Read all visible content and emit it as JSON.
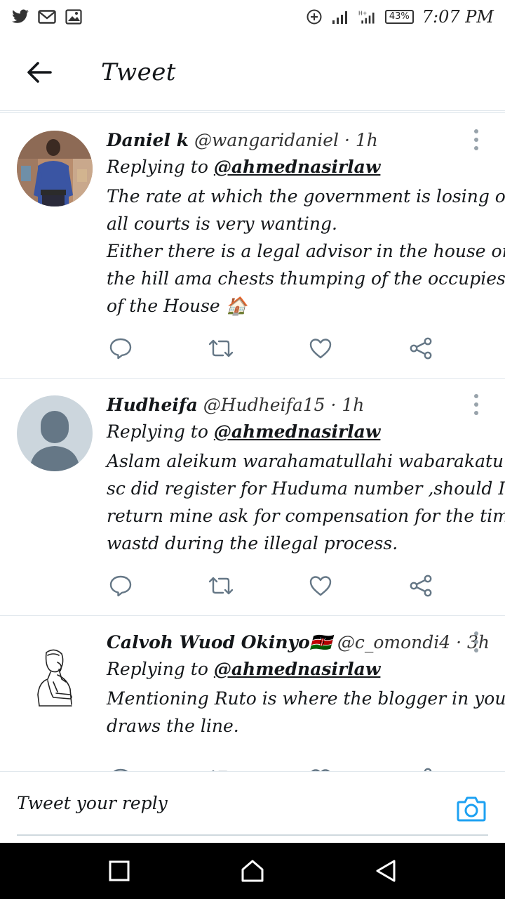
{
  "status_bar": {
    "left_icons": [
      "twitter-bird-icon",
      "gmail-icon",
      "image-icon"
    ],
    "right_icons": [
      "data-saver-icon",
      "signal-icon",
      "signal-h-plus-icon"
    ],
    "battery": "43%",
    "time": "7:07 PM"
  },
  "app_bar": {
    "title": "Tweet",
    "back_icon": "arrow-left-icon"
  },
  "tweets": [
    {
      "name": "Daniel k",
      "handle": "@wangaridaniel",
      "sep": "·",
      "time": "1h",
      "replying_prefix": "Replying to",
      "replying_to": "@ahmednasirlaw",
      "lines": [
        "The rate at which the government is losing on",
        "all courts is very wanting.",
        "Either there is a legal advisor in the house on",
        "the hill ama chests thumping of the occupies",
        "of the House 🏠"
      ]
    },
    {
      "name": "Hudheifa",
      "handle": "@Hudheifa15",
      "sep": "·",
      "time": "1h",
      "replying_prefix": "Replying to",
      "replying_to": "@ahmednasirlaw",
      "lines": [
        "Aslam aleikum warahamatullahi wabarakatu",
        "sc did register for Huduma number ,should I",
        "return mine ask for compensation for the time",
        "wastd during the illegal process."
      ]
    },
    {
      "name": "Calvoh Wuod Okinyo🇰🇪",
      "handle": "@c_omondi4",
      "sep": "·",
      "time": "3h",
      "replying_prefix": "Replying to",
      "replying_to": "@ahmednasirlaw",
      "lines": [
        "Mentioning Ruto is where the blogger in you",
        "draws the line."
      ]
    }
  ],
  "actions": [
    "reply-icon",
    "retweet-icon",
    "like-icon",
    "share-icon"
  ],
  "reply_bar": {
    "placeholder": "Tweet your reply",
    "camera_icon": "camera-icon"
  },
  "nav_bar": {
    "icons": [
      "recents-square-icon",
      "home-icon",
      "back-triangle-icon"
    ]
  },
  "colors": {
    "accent": "#1da1f2",
    "icon_gray": "#657786",
    "divider": "#e1e8ed"
  }
}
